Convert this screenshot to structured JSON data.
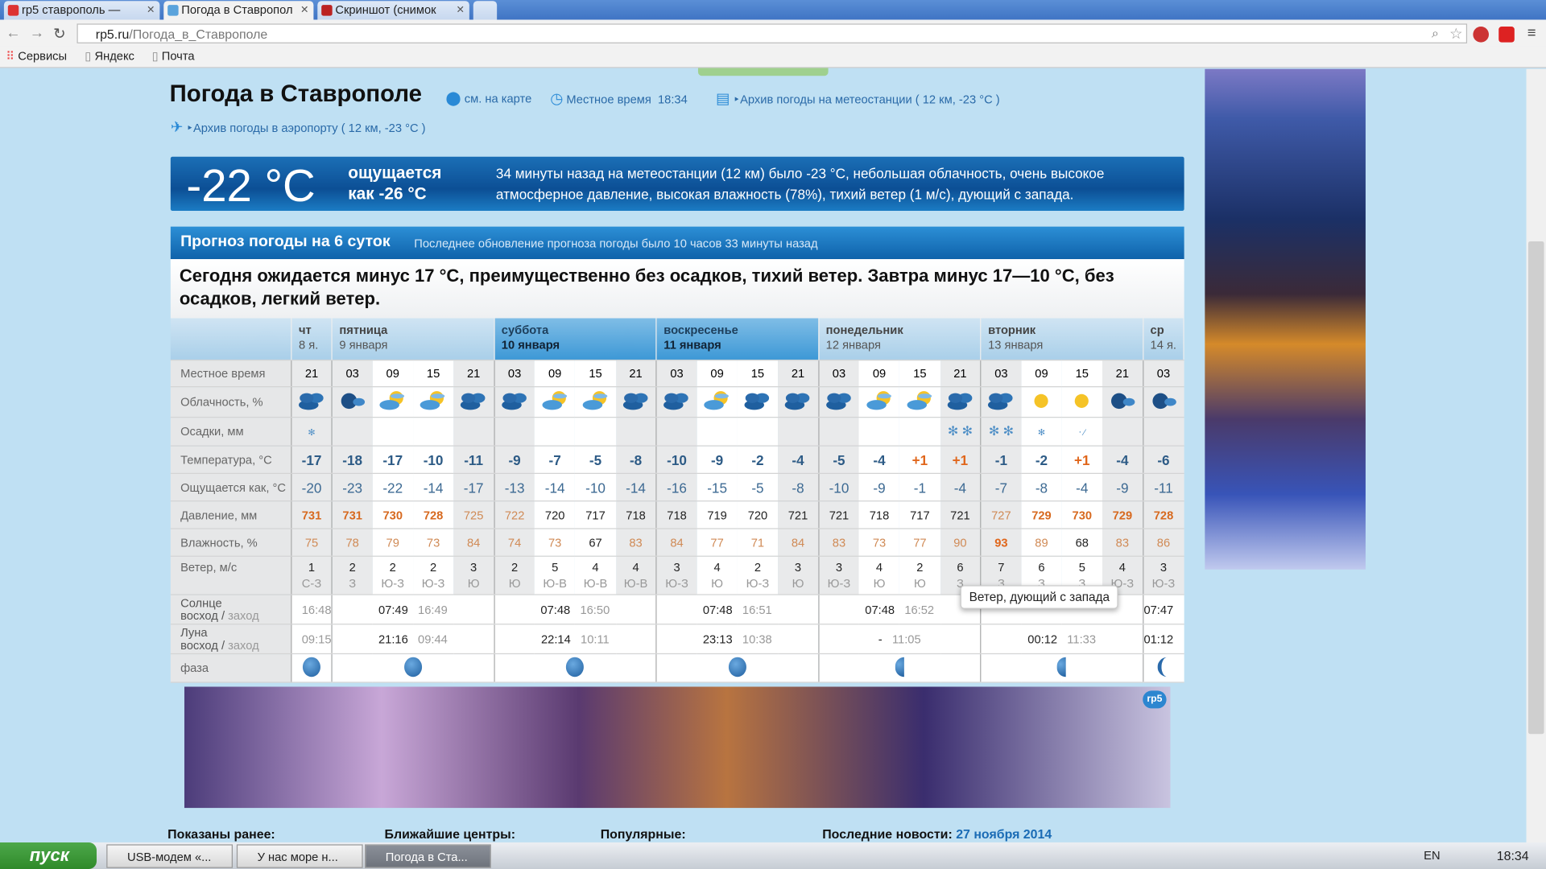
{
  "browser": {
    "tabs": [
      {
        "label": "rp5 ставрополь — ",
        "active": false
      },
      {
        "label": "Погода в Ставропол",
        "active": true
      },
      {
        "label": "Скриншот (снимок",
        "active": false
      }
    ],
    "url_host": "rp5.ru",
    "url_path": "/Погода_в_Ставрополе",
    "bookmarks": [
      "Сервисы",
      "Яндекс",
      "Почта"
    ]
  },
  "header": {
    "title": "Погода в Ставрополе",
    "map_link": "см. на карте",
    "local_time_label": "Местное время",
    "local_time": "18:34",
    "station_archive": "Архив погоды на метеостанции ( 12 км, -23 °C )",
    "airport_archive": "Архив погоды в аэропорту ( 12 км, -23 °C )"
  },
  "current": {
    "temp": "-22 °C",
    "feels_line1": "ощущается",
    "feels_line2": "как -26 °C",
    "description": "34 минуты назад на метеостанции (12 км) было -23 °C, небольшая облачность, очень высокое атмосферное давление, высокая влажность (78%), тихий ветер (1 м/с), дующий с запада."
  },
  "forecast": {
    "title": "Прогноз погоды на 6 суток",
    "updated": "Последнее обновление прогноза погоды было 10 часов 33 минуты назад",
    "summary": "Сегодня ожидается минус 17 °C, преимущественно без осадков, тихий ветер. Завтра минус 17—10 °C, без осадков, легкий ветер.",
    "row_labels": {
      "time": "Местное время",
      "clouds": "Облачность, %",
      "precip": "Осадки, мм",
      "temp": "Температура, °C",
      "feels": "Ощущается как, °C",
      "pressure": "Давление, мм",
      "humidity": "Влажность, %",
      "wind": "Ветер, м/с",
      "sun_title": "Солнце",
      "moon_title": "Луна",
      "rise": "восход",
      "set": "заход",
      "phase": "фаза"
    },
    "days": [
      {
        "name": "чт",
        "date": "8 я.",
        "cols": 1,
        "weekend": false,
        "sunrise": "",
        "sunset": "16:48",
        "moonrise": "",
        "moonset": "09:15",
        "phase": "waxing-gibbous"
      },
      {
        "name": "пятница",
        "date": "9 января",
        "cols": 4,
        "weekend": false,
        "sunrise": "07:49",
        "sunset": "16:49",
        "moonrise": "21:16",
        "moonset": "09:44",
        "phase": "waning-gibbous"
      },
      {
        "name": "суббота",
        "date": "10 января",
        "cols": 4,
        "weekend": true,
        "sunrise": "07:48",
        "sunset": "16:50",
        "moonrise": "22:14",
        "moonset": "10:11",
        "phase": "waning-gibbous"
      },
      {
        "name": "воскресенье",
        "date": "11 января",
        "cols": 4,
        "weekend": true,
        "sunrise": "07:48",
        "sunset": "16:51",
        "moonrise": "23:13",
        "moonset": "10:38",
        "phase": "waning-gibbous"
      },
      {
        "name": "понедельник",
        "date": "12 января",
        "cols": 4,
        "weekend": false,
        "sunrise": "07:48",
        "sunset": "16:52",
        "moonrise": "-",
        "moonset": "11:05",
        "phase": "last-quarter"
      },
      {
        "name": "вторник",
        "date": "13 января",
        "cols": 4,
        "weekend": false,
        "sunrise": "",
        "sunset": "",
        "moonrise": "00:12",
        "moonset": "11:33",
        "phase": "last-quarter"
      },
      {
        "name": "ср",
        "date": "14 я.",
        "cols": 1,
        "weekend": false,
        "sunrise": "07:47",
        "sunset": "",
        "moonrise": "01:12",
        "moonset": "",
        "phase": "waning-crescent"
      }
    ],
    "times": [
      "21",
      "03",
      "09",
      "15",
      "21",
      "03",
      "09",
      "15",
      "21",
      "03",
      "09",
      "15",
      "21",
      "03",
      "09",
      "15",
      "21",
      "03",
      "09",
      "15",
      "21",
      "03"
    ],
    "clouds": [
      "overcast-night",
      "partly-cloudy-night",
      "cloudy-sun",
      "cloudy-sun",
      "overcast-night",
      "overcast",
      "cloudy-sun",
      "cloudy-sun",
      "overcast-night",
      "overcast-night",
      "cloudy-sun",
      "overcast",
      "overcast-night",
      "overcast-night",
      "cloudy-sun",
      "cloudy-sun",
      "overcast",
      "overcast",
      "clear-sun",
      "clear-sun",
      "partly-cloudy-night",
      "partly-cloudy-night"
    ],
    "precip": [
      "light-snow",
      "",
      "",
      "",
      "",
      "",
      "",
      "",
      "",
      "",
      "",
      "",
      "",
      "",
      "",
      "",
      "snow",
      "snow",
      "light-snow",
      "sleet",
      "",
      ""
    ],
    "temp": [
      "-17",
      "-18",
      "-17",
      "-10",
      "-11",
      "-9",
      "-7",
      "-5",
      "-8",
      "-10",
      "-9",
      "-2",
      "-4",
      "-5",
      "-4",
      "+1",
      "+1",
      "-1",
      "-2",
      "+1",
      "-4",
      "-6"
    ],
    "feels": [
      "-20",
      "-23",
      "-22",
      "-14",
      "-17",
      "-13",
      "-14",
      "-10",
      "-14",
      "-16",
      "-15",
      "-5",
      "-8",
      "-10",
      "-9",
      "-1",
      "-4",
      "-7",
      "-8",
      "-4",
      "-9",
      "-11"
    ],
    "pressure": [
      "731",
      "731",
      "730",
      "728",
      "725",
      "722",
      "720",
      "717",
      "718",
      "718",
      "719",
      "720",
      "721",
      "721",
      "718",
      "717",
      "721",
      "727",
      "729",
      "730",
      "729",
      "728"
    ],
    "pressure_level": [
      "high",
      "high",
      "high",
      "high",
      "mid",
      "mid",
      "norm",
      "norm",
      "norm",
      "norm",
      "norm",
      "norm",
      "norm",
      "norm",
      "norm",
      "norm",
      "norm",
      "mid",
      "high",
      "high",
      "high",
      "high"
    ],
    "humidity": [
      "75",
      "78",
      "79",
      "73",
      "84",
      "74",
      "73",
      "67",
      "83",
      "84",
      "77",
      "71",
      "84",
      "83",
      "73",
      "77",
      "90",
      "93",
      "89",
      "68",
      "83",
      "86"
    ],
    "humidity_level": [
      "mid",
      "mid",
      "mid",
      "mid",
      "mid",
      "mid",
      "mid",
      "norm",
      "mid",
      "mid",
      "mid",
      "mid",
      "mid",
      "mid",
      "mid",
      "mid",
      "mid",
      "high",
      "mid",
      "norm",
      "mid",
      "mid"
    ],
    "wind_speed": [
      "1",
      "2",
      "2",
      "2",
      "3",
      "2",
      "5",
      "4",
      "4",
      "3",
      "4",
      "2",
      "3",
      "3",
      "4",
      "2",
      "6",
      "7",
      "6",
      "5",
      "4",
      "3"
    ],
    "wind_dir": [
      "С-З",
      "З",
      "Ю-З",
      "Ю-З",
      "Ю",
      "Ю",
      "Ю-В",
      "Ю-В",
      "Ю-В",
      "Ю-З",
      "Ю",
      "Ю-З",
      "Ю",
      "Ю-З",
      "Ю",
      "Ю",
      "З",
      "З",
      "З",
      "З",
      "Ю-З",
      "Ю-З"
    ],
    "tooltip": "Ветер, дующий с запада"
  },
  "footer": {
    "shown_before": "Показаны ранее:",
    "nearest": "Ближайшие центры:",
    "popular": "Популярные:",
    "news_label": "Последние новости:",
    "news_date": "27 ноября 2014"
  },
  "banner_logo": "rp5",
  "taskbar": {
    "start": "пуск",
    "tasks": [
      {
        "label": "USB-модем «...",
        "active": false
      },
      {
        "label": "У нас море н...",
        "active": false
      },
      {
        "label": "Погода в Ста...",
        "active": true
      }
    ],
    "lang": "EN",
    "clock": "18:34"
  },
  "colors": {
    "accent": "#1b6fb6",
    "negative_temp": "#2d5b86",
    "positive_temp": "#e0661b",
    "page_bg": "#bfe0f3"
  }
}
